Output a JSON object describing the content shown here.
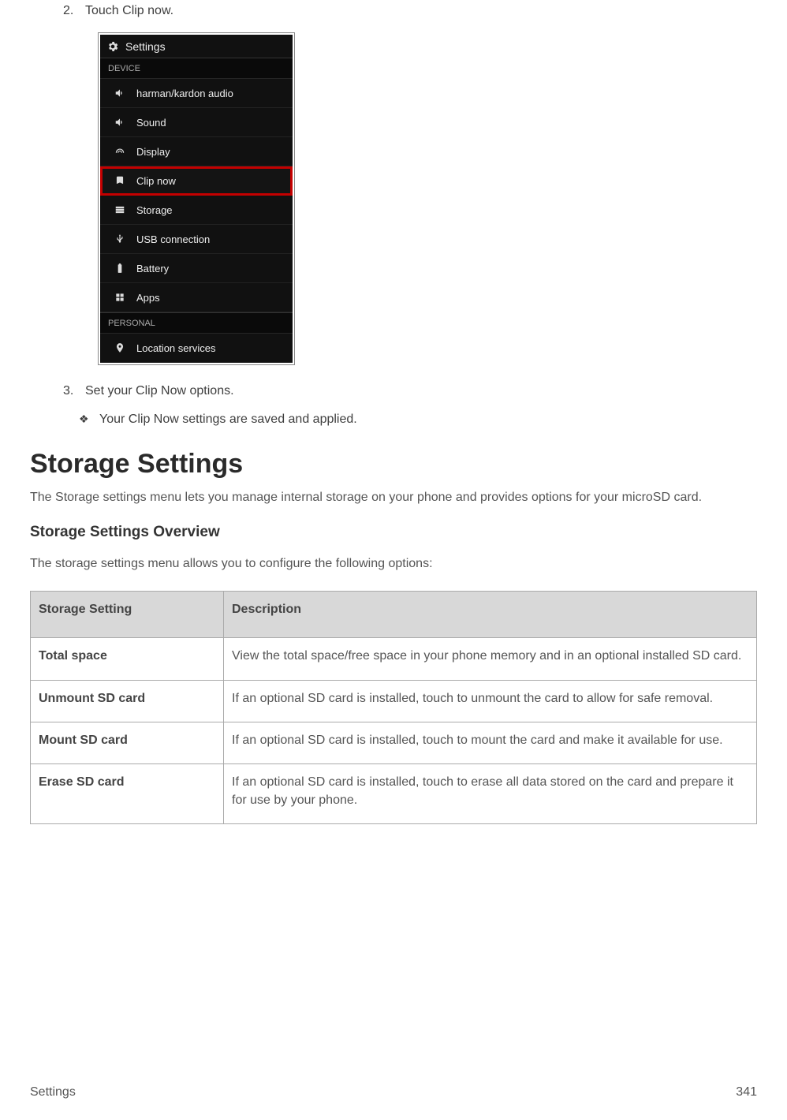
{
  "steps": {
    "s2_num": "2.",
    "s2_text": "Touch Clip now.",
    "s3_num": "3.",
    "s3_text": "Set your Clip Now options.",
    "bullet_sym": "❖",
    "bullet_text": "Your Clip Now settings are saved and applied."
  },
  "screenshot": {
    "title": "Settings",
    "section1": "DEVICE",
    "items": [
      {
        "label": "harman/kardon audio",
        "icon": "speaker"
      },
      {
        "label": "Sound",
        "icon": "speaker"
      },
      {
        "label": "Display",
        "icon": "display"
      },
      {
        "label": "Clip now",
        "icon": "clip",
        "highlight": true
      },
      {
        "label": "Storage",
        "icon": "storage"
      },
      {
        "label": "USB connection",
        "icon": "usb"
      },
      {
        "label": "Battery",
        "icon": "battery"
      },
      {
        "label": "Apps",
        "icon": "apps"
      }
    ],
    "section2": "PERSONAL",
    "items2": [
      {
        "label": "Location services",
        "icon": "location"
      }
    ]
  },
  "h1": "Storage Settings",
  "intro": "The Storage settings menu lets you manage internal storage on your phone and provides options for your microSD card.",
  "h2": "Storage Settings Overview",
  "intro2": "The storage settings menu allows you to configure the following options:",
  "table": {
    "head1": "Storage Setting",
    "head2": "Description",
    "rows": [
      {
        "label": "Total space",
        "desc": "View the total space/free space in your phone memory and in an optional installed SD card."
      },
      {
        "label": "Unmount SD card",
        "desc": "If an optional SD card is installed, touch to unmount the card to allow for safe removal."
      },
      {
        "label": "Mount SD card",
        "desc": "If an optional SD card is installed, touch to mount the card and make it available for use."
      },
      {
        "label": "Erase SD card",
        "desc": "If an optional SD card is installed, touch to erase all data stored on the card and prepare it for use by your phone."
      }
    ]
  },
  "footer": {
    "left": "Settings",
    "right": "341"
  }
}
